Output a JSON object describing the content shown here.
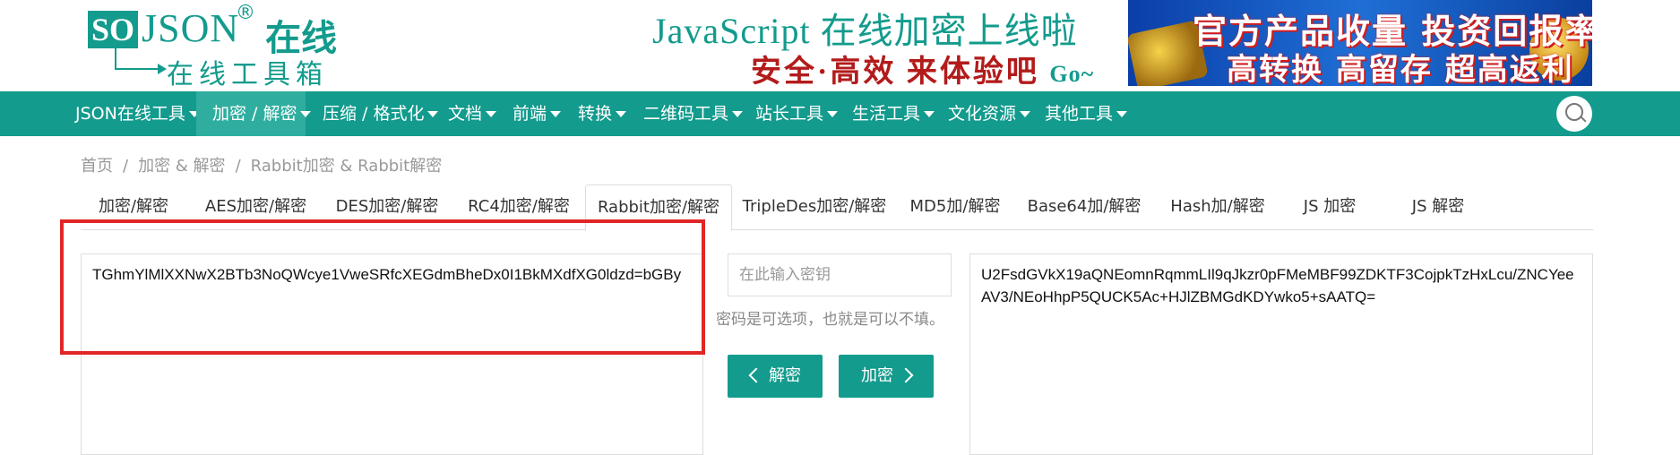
{
  "logo": {
    "box_text": "SO",
    "main_text": "JSON",
    "reg_mark": "®",
    "cn_text": "在线",
    "sub_text": "在线工具箱"
  },
  "promo": {
    "line1": "JavaScript 在线加密上线啦",
    "line2": "安全·高效 来体验吧",
    "line2_suffix": "Go~"
  },
  "ad": {
    "line1": "官方产品收量 投资回报率首选",
    "line2": "高转换 高留存 超高返利"
  },
  "nav": {
    "items": [
      {
        "label": "JSON在线工具"
      },
      {
        "label": "加密 / 解密"
      },
      {
        "label": "压缩 / 格式化"
      },
      {
        "label": "文档"
      },
      {
        "label": "前端"
      },
      {
        "label": "转换"
      },
      {
        "label": "二维码工具"
      },
      {
        "label": "站长工具"
      },
      {
        "label": "生活工具"
      },
      {
        "label": "文化资源"
      },
      {
        "label": "其他工具"
      }
    ],
    "active_index": 1
  },
  "breadcrumb": {
    "items": [
      "首页",
      "加密 & 解密",
      "Rabbit加密 & Rabbit解密"
    ],
    "separator": "/"
  },
  "tabs": {
    "items": [
      {
        "label": "加密/解密"
      },
      {
        "label": "AES加密/解密"
      },
      {
        "label": "DES加密/解密"
      },
      {
        "label": "RC4加密/解密"
      },
      {
        "label": "Rabbit加密/解密"
      },
      {
        "label": "TripleDes加密/解密"
      },
      {
        "label": "MD5加/解密"
      },
      {
        "label": "Base64加/解密"
      },
      {
        "label": "Hash加/解密"
      },
      {
        "label": "JS 加密"
      },
      {
        "label": "JS 解密"
      }
    ],
    "active_index": 4
  },
  "main": {
    "plaintext_value": "TGhmYlMlXXNwX2BTb3NoQWcye1VweSRfcXEGdmBheDx0I1BkMXdfXG0ldzd=bGBy",
    "key_placeholder": "在此输入密钥",
    "key_hint": "密码是可选项，也就是可以不填。",
    "decrypt_label": "解密",
    "encrypt_label": "加密",
    "ciphertext_value": "U2FsdGVkX19aQNEomnRqmmLIl9qJkzr0pFMeMBF99ZDKTF3CojpkTzHxLcu/ZNCYeeAV3/NEoHhpP5QUCK5Ac+HJlZBMGdKDYwko5+sAATQ="
  },
  "colors": {
    "brand": "#139b8d",
    "nav_active": "#2fae9f",
    "highlight": "#e02626"
  }
}
